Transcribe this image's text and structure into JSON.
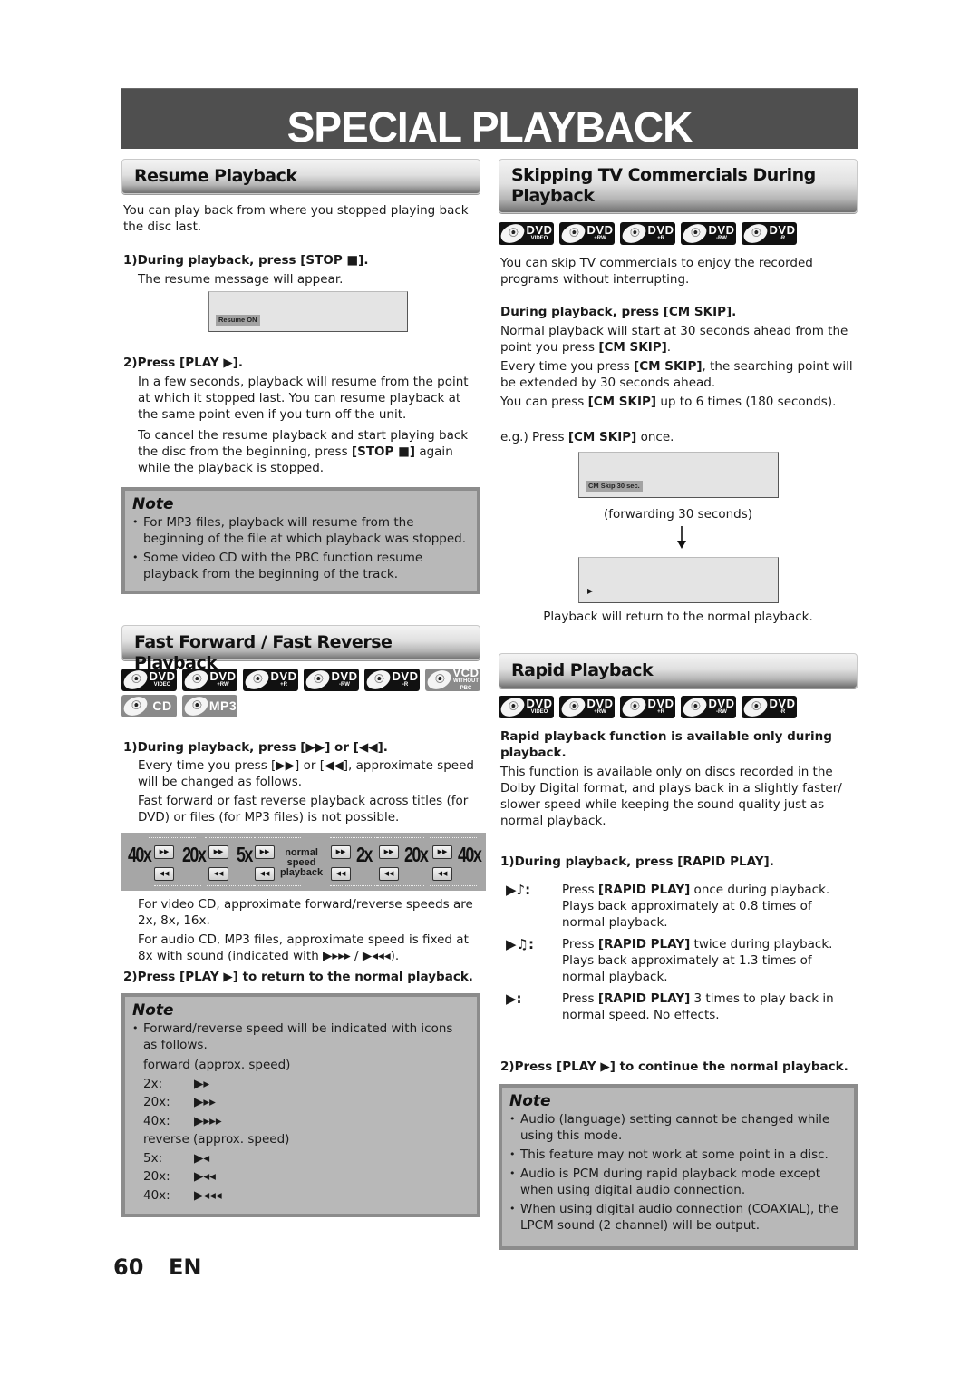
{
  "page_title": "SPECIAL PLAYBACK",
  "resume": {
    "heading": "Resume Playback",
    "intro": "You can play back from where you stopped playing back the disc last.",
    "step1_title": "1)During playback, press [STOP ■].",
    "step1_text": "The resume message will appear.",
    "screen_msg": "Resume ON",
    "step2_title": "2)Press [PLAY ▶].",
    "step2_text1": "In a few seconds, playback will resume from the point at which it stopped last. You can resume playback at the same point even if you turn off the unit.",
    "step2_text2_a": "To cancel the resume playback and start playing back the disc from the beginning, press ",
    "step2_text2_b": "[STOP ■]",
    "step2_text2_c": " again while the playback is stopped.",
    "note_title": "Note",
    "notes": [
      "For MP3 files, playback will resume from the beginning of the file at which playback was stopped.",
      "Some video CD with the PBC function resume playback from the beginning of the track."
    ]
  },
  "ff": {
    "heading": "Fast Forward / Fast Reverse Playback",
    "discs": [
      {
        "big": "DVD",
        "small": "VIDEO"
      },
      {
        "big": "DVD",
        "small": "+RW"
      },
      {
        "big": "DVD",
        "small": "+R"
      },
      {
        "big": "DVD",
        "small": "-RW"
      },
      {
        "big": "DVD",
        "small": "-R"
      },
      {
        "big": "VCD",
        "small": "WITHOUT PBC"
      },
      {
        "big": "CD",
        "small": ""
      },
      {
        "big": "MP3",
        "small": ""
      }
    ],
    "step1_title": "1)During playback, press [▶▶] or [◀◀].",
    "step1_text1": "Every time you press [▶▶] or [◀◀], approximate speed will be changed as follows.",
    "step1_text2": "Fast forward or fast reverse playback across titles (for DVD) or files (for MP3 files) is not possible.",
    "speed_diagram": {
      "labels": [
        "40x",
        "20x",
        "5x",
        "2x",
        "20x",
        "40x"
      ],
      "center_label": [
        "normal",
        "speed",
        "playback"
      ],
      "ff_button": "▶▶",
      "rew_button": "◀◀"
    },
    "vcd_text": "For video CD, approximate forward/reverse speeds are 2x, 8x, 16x.",
    "audio_text": "For audio CD, MP3 files, approximate speed is fixed at 8x with sound (indicated with ▶▸▸▸ / ▶◂◂◂).",
    "step2_title": "2)Press [PLAY ▶] to return to the normal playback.",
    "note_title": "Note",
    "note_intro": "Forward/reverse speed will be indicated with icons as follows.",
    "forward_label": "forward (approx. speed)",
    "forward": [
      {
        "speed": "2x:",
        "icon": "▶▸"
      },
      {
        "speed": "20x:",
        "icon": "▶▸▸"
      },
      {
        "speed": "40x:",
        "icon": "▶▸▸▸"
      }
    ],
    "reverse_label": "reverse (approx. speed)",
    "reverse": [
      {
        "speed": "5x:",
        "icon": "▶◂"
      },
      {
        "speed": "20x:",
        "icon": "▶◂◂"
      },
      {
        "speed": "40x:",
        "icon": "▶◂◂◂"
      }
    ]
  },
  "cmskip": {
    "heading": "Skipping TV Commercials During Playback",
    "discs": [
      {
        "big": "DVD",
        "small": "VIDEO"
      },
      {
        "big": "DVD",
        "small": "+RW"
      },
      {
        "big": "DVD",
        "small": "+R"
      },
      {
        "big": "DVD",
        "small": "-RW"
      },
      {
        "big": "DVD",
        "small": "-R"
      }
    ],
    "intro": "You can skip TV commercials to enjoy the recorded programs without interrupting.",
    "step_title": "During playback, press [CM SKIP].",
    "line1_a": "Normal playback will start at 30 seconds ahead from the point you press ",
    "line1_b": "[CM SKIP]",
    "line1_c": ".",
    "line2_a": "Every time you press ",
    "line2_b": "[CM SKIP]",
    "line2_c": ", the searching point will be extended by 30 seconds ahead.",
    "line3_a": "You can press ",
    "line3_b": "[CM SKIP]",
    "line3_c": " up to 6 times (180 seconds).",
    "eg_a": "e.g.) Press ",
    "eg_b": "[CM SKIP]",
    "eg_c": " once.",
    "screen_msg": "CM Skip 30 sec.",
    "forwarding": "(forwarding 30 seconds)",
    "play_symbol": "▶",
    "return_text": "Playback will return to the normal playback."
  },
  "rapid": {
    "heading": "Rapid Playback",
    "discs": [
      {
        "big": "DVD",
        "small": "VIDEO"
      },
      {
        "big": "DVD",
        "small": "+RW"
      },
      {
        "big": "DVD",
        "small": "+R"
      },
      {
        "big": "DVD",
        "small": "-RW"
      },
      {
        "big": "DVD",
        "small": "-R"
      }
    ],
    "bold_intro": "Rapid playback function is available only during playback.",
    "intro": "This function is available only on discs recorded in the Dolby Digital format, and plays back in a slightly faster/ slower speed while keeping the sound quality just as normal playback.",
    "step1_title": "1)During playback, press [RAPID PLAY].",
    "modes": [
      {
        "symbol": "▶♪:",
        "a": "Press ",
        "b": "[RAPID PLAY]",
        "c": " once during playback. Plays back approximately at 0.8 times of normal playback."
      },
      {
        "symbol": "▶♫:",
        "a": "Press ",
        "b": "[RAPID PLAY]",
        "c": " twice during playback. Plays back approximately at 1.3 times of normal playback."
      },
      {
        "symbol": "▶:",
        "a": "Press ",
        "b": "[RAPID PLAY]",
        "c": " 3 times to play back in normal speed. No effects."
      }
    ],
    "step2_title": "2)Press [PLAY ▶] to continue the normal playback.",
    "note_title": "Note",
    "notes": [
      "Audio (language) setting cannot be changed while using this mode.",
      "This feature may not work at some point in a disc.",
      "Audio is PCM during rapid playback mode except when using digital audio connection.",
      "When using digital audio connection (COAXIAL), the LPCM sound (2 channel) will be output."
    ]
  },
  "footer": {
    "page_number": "60",
    "language": "EN"
  }
}
